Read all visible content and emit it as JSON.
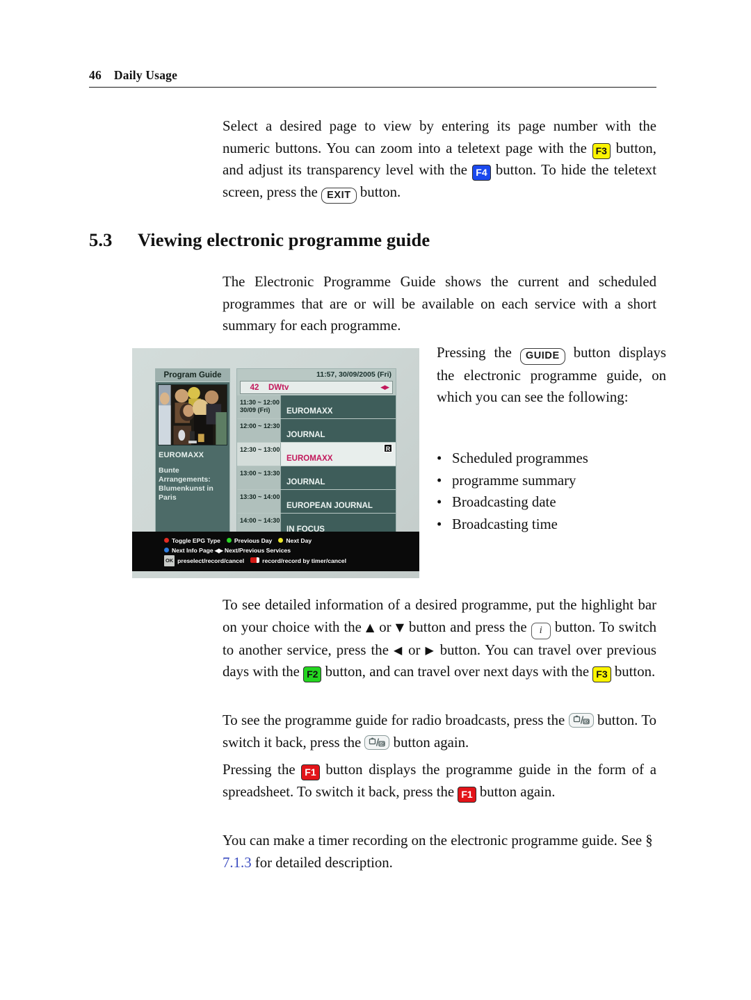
{
  "page": {
    "number": "46",
    "chapter": "Daily Usage"
  },
  "intro_paragraph": {
    "t1": "Select a desired page to view by entering its page number with the numeric buttons. You can zoom into a teletext page with the ",
    "k1": "F3",
    "t2": " button, and adjust its transparency level with the ",
    "k2": "F4",
    "t3": " button. To hide the teletext screen, press the ",
    "k3": "EXIT",
    "t4": " button."
  },
  "section": {
    "number": "5.3",
    "title": "Viewing electronic programme guide"
  },
  "epg_intro": "The Electronic Programme Guide shows the current and scheduled programmes that are or will be available on each service with a short summary for each programme.",
  "guide_para": {
    "t1": "Pressing the ",
    "k1": "GUIDE",
    "t2": " button displays the electronic programme guide, on which you can see the following:"
  },
  "bullets": [
    "Scheduled programmes",
    "programme summary",
    "Broadcasting date",
    "Broadcasting time"
  ],
  "bullet_char": "•",
  "detail_para": {
    "t1": "To see detailed information of a desired programme, put the highlight bar on your choice with the ",
    "a_up": "▲",
    "t2": " or ",
    "a_down": "▼",
    "t3": " button and press the ",
    "k_info": "i",
    "t4": " button. To switch to another service, press the ",
    "a_left": "◀",
    "t5": " or ",
    "a_right": "▶",
    "t6": " button. You can travel over previous days with the ",
    "k_f2": "F2",
    "t7": " button, and can travel over next days with the ",
    "k_f3": "F3",
    "t8": " button."
  },
  "radio_para": {
    "t1": "To see the programme guide for radio broadcasts, press the ",
    "k1": "tv-radio-icon",
    "t2": " button. To switch it back, press the ",
    "k2": "tv-radio-icon",
    "t3": " button again."
  },
  "spreadsheet_para": {
    "t1": "Pressing the ",
    "k1": "F1",
    "t2": " button displays the programme guide in the form of a spreadsheet. To switch it back, press the ",
    "k2": "F1",
    "t3": " button again."
  },
  "timer_para": {
    "t1": "You can make a timer recording on the electronic programme guide. See § ",
    "xref": "7.1.3",
    "t2": " for detailed description."
  },
  "figure": {
    "left_panel": {
      "title": "Program Guide",
      "programme_name": "EUROMAXX",
      "description_line1": "Bunte Arrangements:",
      "description_line2": "Blumenkunst in Paris"
    },
    "right_panel": {
      "clock": "11:57, 30/09/2005 (Fri)",
      "channel_number": "42",
      "channel_name": "DWtv",
      "service_arrows": "◀▶",
      "rows": [
        {
          "time": "11:30 ~ 12:00",
          "date": "30/09 (Fri)",
          "title": "EUROMAXX",
          "selected": false,
          "recorded": false
        },
        {
          "time": "12:00 ~ 12:30",
          "date": "",
          "title": "JOURNAL",
          "selected": false,
          "recorded": false
        },
        {
          "time": "12:30 ~ 13:00",
          "date": "",
          "title": "EUROMAXX",
          "selected": true,
          "recorded": true,
          "record_mark": "R"
        },
        {
          "time": "13:00 ~ 13:30",
          "date": "",
          "title": "JOURNAL",
          "selected": false,
          "recorded": false
        },
        {
          "time": "13:30 ~ 14:00",
          "date": "",
          "title": "EUROPEAN JOURNAL",
          "selected": false,
          "recorded": false
        },
        {
          "time": "14:00 ~ 14:30",
          "date": "",
          "title": "IN FOCUS",
          "selected": false,
          "recorded": false
        }
      ]
    },
    "help_bar": {
      "line1_a": "Toggle EPG Type",
      "line1_b": "Previous Day",
      "line1_c": "Next Day",
      "line2_a": "Next Info Page",
      "line2_b": "Next/Previous Services",
      "line3_ok": "OK",
      "line3_a": "preselect/record/cancel",
      "line3_b": "record/record by timer/cancel"
    }
  },
  "colors": {
    "f1": "#e31419",
    "f2": "#24d520",
    "f3": "#fcf400",
    "f4": "#1b49ee",
    "xref": "#3b4cc0"
  }
}
